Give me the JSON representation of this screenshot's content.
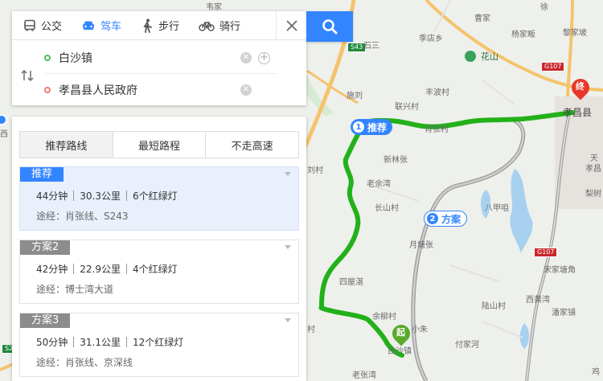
{
  "tabs": [
    {
      "label": "公交",
      "icon": "bus-icon",
      "active": false
    },
    {
      "label": "驾车",
      "icon": "car-icon",
      "active": true
    },
    {
      "label": "步行",
      "icon": "walk-icon",
      "active": false
    },
    {
      "label": "骑行",
      "icon": "bike-icon",
      "active": false
    }
  ],
  "route": {
    "start": "白沙镇",
    "end": "孝昌县人民政府"
  },
  "strategy_tabs": [
    "推荐路线",
    "最短路程",
    "不走高速"
  ],
  "plans": [
    {
      "badge": "推荐",
      "time": "44分钟",
      "distance": "30.3公里",
      "lights": "6个红绿灯",
      "via": "途经：肖张线、S243",
      "selected": true
    },
    {
      "badge": "方案2",
      "time": "42分钟",
      "distance": "22.9公里",
      "lights": "4个红绿灯",
      "via": "途经：博士湾大道",
      "selected": false
    },
    {
      "badge": "方案3",
      "time": "50分钟",
      "distance": "31.1公里",
      "lights": "12个红绿灯",
      "via": "途经：肖张线、京深线",
      "selected": false
    }
  ],
  "map": {
    "route_tags": {
      "recommended": {
        "num": "1",
        "label": "推荐"
      },
      "plan2": {
        "num": "2",
        "label": "方案"
      }
    },
    "markers": {
      "start": "起",
      "end": "终"
    },
    "road_shields": [
      "S43",
      "G107",
      "G107",
      "S243"
    ],
    "pois": [
      "花山"
    ],
    "labels": [
      "季店乡",
      "杨家畈",
      "丰波村",
      "施刘",
      "联兴村",
      "孝昌县",
      "肖张村",
      "刘村",
      "新林张",
      "老余湾",
      "长山村",
      "八甲咀",
      "月塘张",
      "四屋湛",
      "陆山村",
      "宋家塘角",
      "西黄湾",
      "余柳村",
      "小朱",
      "付家河",
      "潘家铺",
      "白沙镇",
      "老张湾",
      "黎家坡",
      "天",
      "孝昌",
      "梨树",
      "鸡",
      "西",
      "徐",
      "曹家",
      "石三",
      "韦家",
      "村"
    ]
  },
  "colors": {
    "accent": "#3385ff",
    "route_main": "#22b11a",
    "route_alt": "#9a9a9a",
    "start_pin": "#5aaa2e",
    "end_pin": "#e8382a",
    "badge_gray": "#8c8c8c"
  }
}
